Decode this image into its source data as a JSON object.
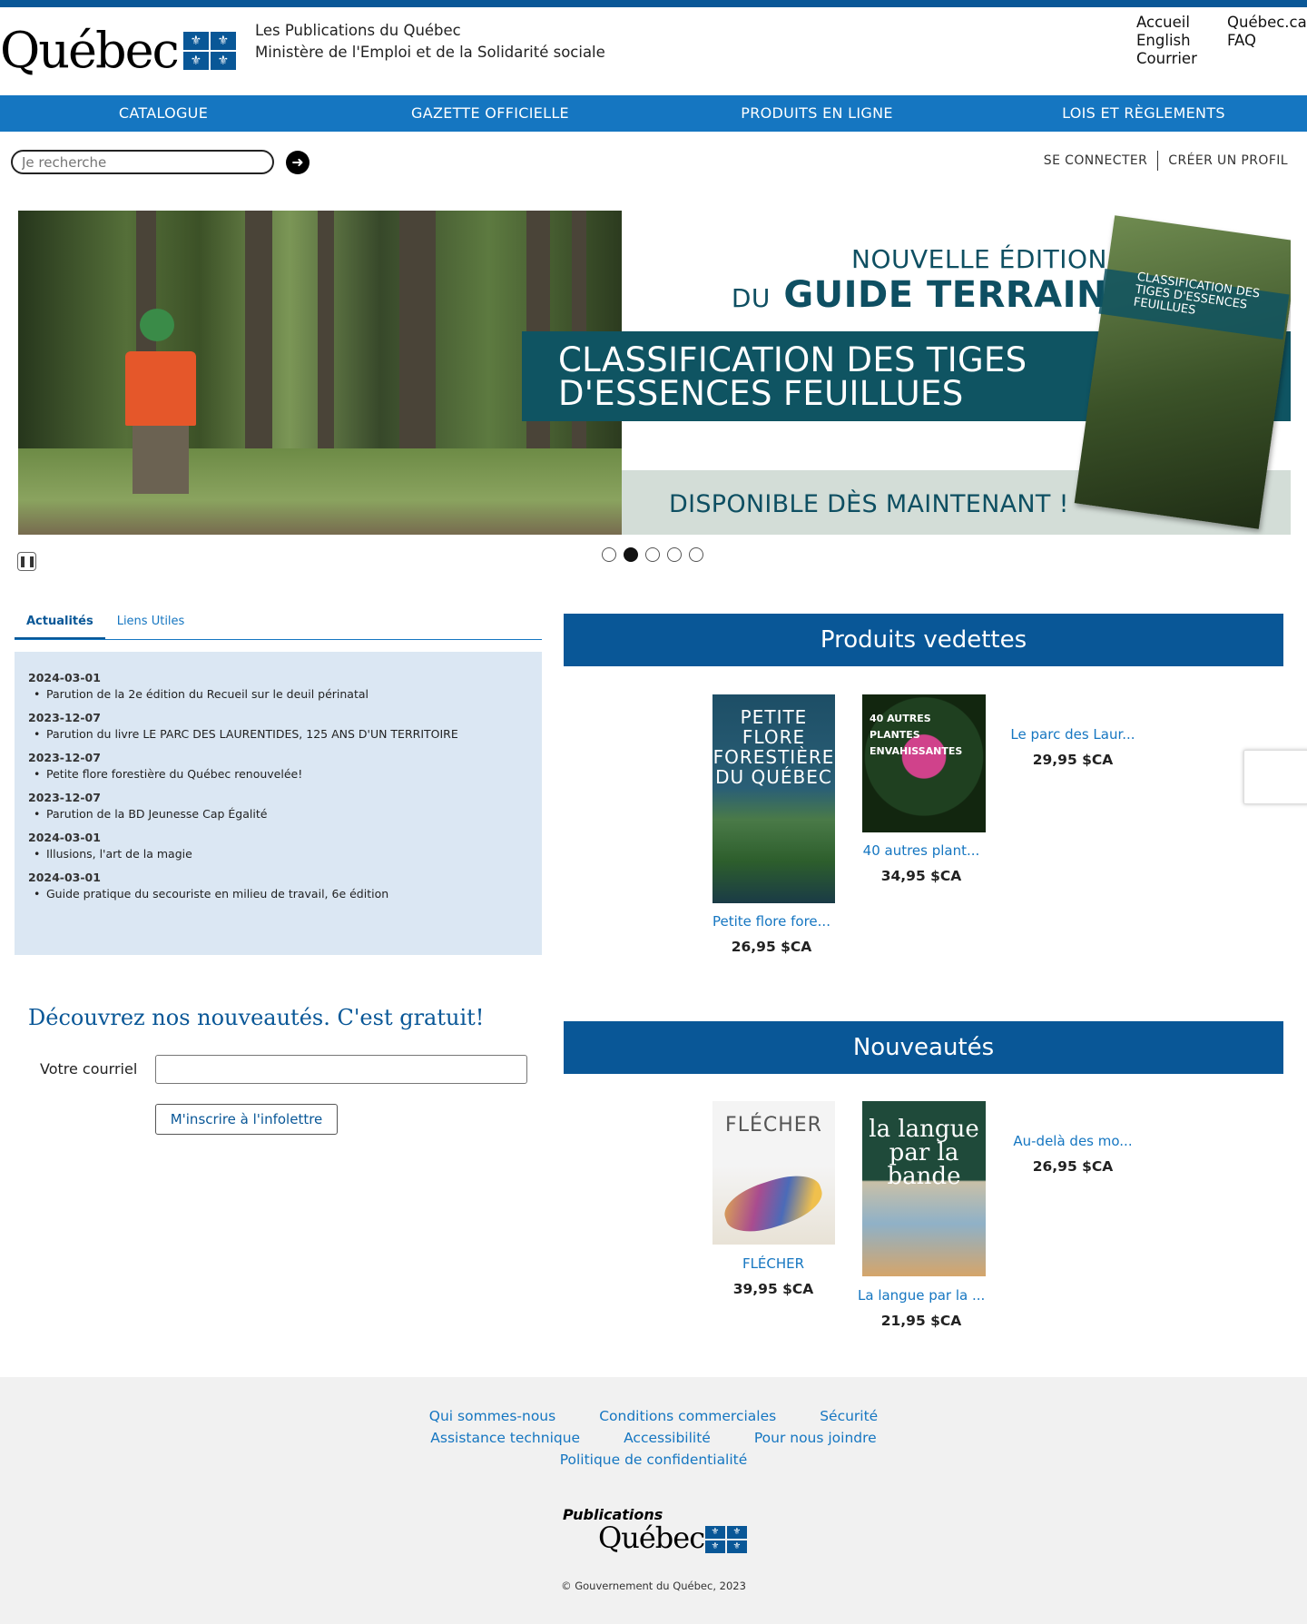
{
  "header": {
    "logo_text": "Québec",
    "org_line1": "Les Publications du Québec",
    "org_line2": "Ministère de l'Emploi et de la Solidarité sociale",
    "links": [
      "Accueil",
      "Québec.ca",
      "English",
      "FAQ",
      "Courrier"
    ]
  },
  "nav": [
    "CATALOGUE",
    "GAZETTE OFFICIELLE",
    "PRODUITS EN LIGNE",
    "LOIS ET RÈGLEMENTS"
  ],
  "search": {
    "placeholder": "Je recherche"
  },
  "auth": {
    "login": "SE CONNECTER",
    "register": "CRÉER UN PROFIL"
  },
  "banner": {
    "line1": "NOUVELLE ÉDITION",
    "line2_prefix": "DU",
    "line2": "GUIDE TERRAIN",
    "band_line1": "CLASSIFICATION DES TIGES",
    "band_line2": "D'ESSENCES FEUILLUES",
    "footer": "DISPONIBLE DÈS MAINTENANT !",
    "cover_title": "CLASSIFICATION DES TIGES D'ESSENCES FEUILLUES",
    "slide_count": 5,
    "active_slide": 2
  },
  "tabs": [
    "Actualités",
    "Liens Utiles"
  ],
  "news": [
    {
      "date": "2024-03-01",
      "text": "Parution de la 2e édition du Recueil sur le deuil périnatal"
    },
    {
      "date": "2023-12-07",
      "text": "Parution du livre LE PARC DES LAURENTIDES, 125 ANS D'UN TERRITOIRE"
    },
    {
      "date": "2023-12-07",
      "text": "Petite flore forestière du Québec renouvelée!"
    },
    {
      "date": "2023-12-07",
      "text": "Parution de la BD Jeunesse Cap Égalité"
    },
    {
      "date": "2024-03-01",
      "text": "Illusions, l'art de la magie"
    },
    {
      "date": "2024-03-01",
      "text": "Guide pratique du secouriste en milieu de travail, 6e édition"
    }
  ],
  "newsletter": {
    "title": "Découvrez nos nouveautés. C'est gratuit!",
    "label": "Votre courriel",
    "button": "M'inscrire à l'infolettre"
  },
  "featured": {
    "title": "Produits vedettes",
    "items": [
      {
        "name": "Petite flore fore...",
        "price": "26,95 $CA",
        "cover": "PETITE FLORE FORESTIÈRE DU QUÉBEC"
      },
      {
        "name": "40 autres plant...",
        "price": "34,95 $CA",
        "cover": "40 AUTRES PLANTES ENVAHISSANTES"
      },
      {
        "name": "Le parc des Laur...",
        "price": "29,95 $CA"
      }
    ]
  },
  "new_items": {
    "title": "Nouveautés",
    "items": [
      {
        "name": "FLÉCHER",
        "price": "39,95 $CA",
        "cover": "FLÉCHER"
      },
      {
        "name": "La langue par la ...",
        "price": "21,95 $CA",
        "cover": "la langue par la bande"
      },
      {
        "name": "Au-delà des mo...",
        "price": "26,95 $CA"
      }
    ]
  },
  "footer": {
    "row1": [
      "Qui sommes-nous",
      "Conditions commerciales",
      "Sécurité"
    ],
    "row2": [
      "Assistance technique",
      "Accessibilité",
      "Pour nous joindre"
    ],
    "row3": [
      "Politique de confidentialité"
    ],
    "logo_pub": "Publications",
    "logo_qc": "Québec",
    "copyright": "© Gouvernement du Québec, 2023"
  },
  "colors": {
    "brand_blue": "#095797",
    "nav_blue": "#1576c1",
    "news_bg": "#dbe7f3",
    "banner_teal": "#0f5462"
  }
}
